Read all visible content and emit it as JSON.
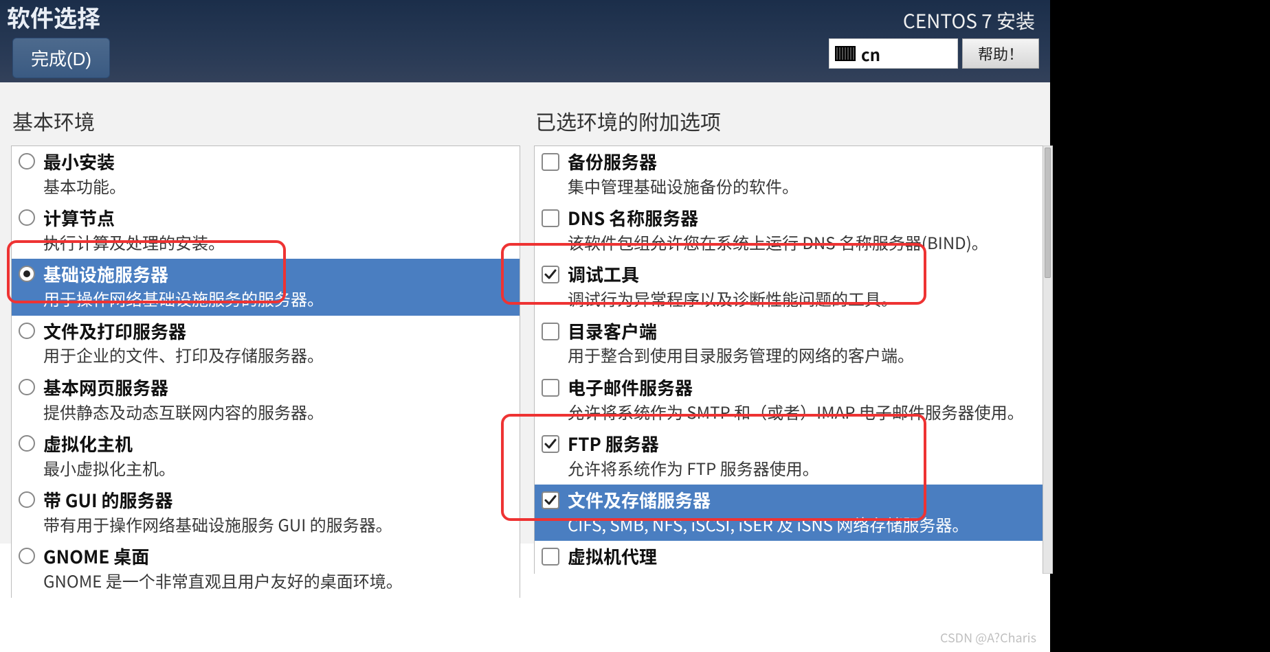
{
  "header": {
    "title": "软件选择",
    "done": "完成(D)",
    "installer": "CENTOS 7 安装",
    "lang": "cn",
    "help": "帮助！"
  },
  "left": {
    "heading": "基本环境",
    "items": [
      {
        "title": "最小安装",
        "desc": "基本功能。",
        "sel": false
      },
      {
        "title": "计算节点",
        "desc": "执行计算及处理的安装。",
        "sel": false
      },
      {
        "title": "基础设施服务器",
        "desc": "用于操作网络基础设施服务的服务器。",
        "sel": true
      },
      {
        "title": "文件及打印服务器",
        "desc": "用于企业的文件、打印及存储服务器。",
        "sel": false
      },
      {
        "title": "基本网页服务器",
        "desc": "提供静态及动态互联网内容的服务器。",
        "sel": false
      },
      {
        "title": "虚拟化主机",
        "desc": "最小虚拟化主机。",
        "sel": false
      },
      {
        "title": "带 GUI 的服务器",
        "desc": "带有用于操作网络基础设施服务 GUI 的服务器。",
        "sel": false
      },
      {
        "title": "GNOME 桌面",
        "desc": "GNOME 是一个非常直观且用户友好的桌面环境。",
        "sel": false
      }
    ]
  },
  "right": {
    "heading": "已选环境的附加选项",
    "items": [
      {
        "title": "备份服务器",
        "desc": "集中管理基础设施备份的软件。",
        "chk": false,
        "sel": false
      },
      {
        "title": "DNS 名称服务器",
        "desc": "该软件包组允许您在系统上运行 DNS 名称服务器(BIND)。",
        "chk": false,
        "sel": false
      },
      {
        "title": "调试工具",
        "desc": "调试行为异常程序以及诊断性能问题的工具。",
        "chk": true,
        "sel": false
      },
      {
        "title": "目录客户端",
        "desc": "用于整合到使用目录服务管理的网络的客户端。",
        "chk": false,
        "sel": false
      },
      {
        "title": "电子邮件服务器",
        "desc": "允许将系统作为 SMTP 和（或者）IMAP 电子邮件服务器使用。",
        "chk": false,
        "sel": false
      },
      {
        "title": "FTP 服务器",
        "desc": "允许将系统作为 FTP 服务器使用。",
        "chk": true,
        "sel": false
      },
      {
        "title": "文件及存储服务器",
        "desc": "CIFS, SMB, NFS, iSCSI, iSER 及 iSNS 网络存储服务器。",
        "chk": true,
        "sel": true
      },
      {
        "title": "虚拟机代理",
        "desc": "",
        "chk": false,
        "sel": false
      }
    ]
  },
  "watermark": "CSDN @A?Charis"
}
